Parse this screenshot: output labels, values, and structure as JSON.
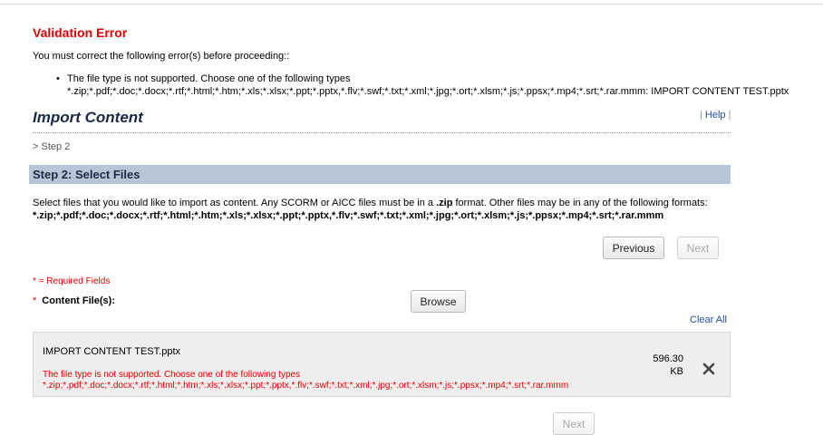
{
  "validation": {
    "title": "Validation Error",
    "intro": "You must correct the following error(s) before proceeding::",
    "error_line1": "The file type is not supported. Choose one of the following types",
    "error_line2": "*.zip;*.pdf;*.doc;*.docx;*.rtf;*.html;*.htm;*.xls;*.xlsx;*.ppt;*.pptx,*.flv;*.swf;*.txt;*.xml;*.jpg;*.ort;*.xlsm;*.js;*.ppsx;*.mp4;*.srt;*.rar.mmm: IMPORT CONTENT TEST.pptx"
  },
  "header": {
    "title": "Import Content",
    "help_label": "Help",
    "breadcrumb": "> Step 2"
  },
  "step": {
    "title": "Step 2: Select Files",
    "description_prefix": "Select files that you would like to import as content. Any SCORM or AICC files must be in a ",
    "description_zip": ".zip",
    "description_suffix": " format. Other files may be in any of the following formats:",
    "formats": "*.zip;*.pdf;*.doc;*.docx;*.rtf;*.html;*.htm;*.xls;*.xlsx;*.ppt;*.pptx,*.flv;*.swf;*.txt;*.xml;*.jpg;*.ort;*.xlsm;*.js;*.ppsx;*.mp4;*.srt;*.rar.mmm"
  },
  "nav": {
    "previous_label": "Previous",
    "next_label": "Next"
  },
  "form": {
    "required_note": "* = Required Fields",
    "required_star": "*",
    "content_files_label": "Content File(s):",
    "browse_label": "Browse",
    "clear_all_label": "Clear All"
  },
  "file": {
    "name": "IMPORT CONTENT TEST.pptx",
    "size_value": "596.30",
    "size_unit": "KB",
    "error_line1": "The file type is not supported. Choose one of the following types",
    "error_line2": "*.zip;*.pdf;*.doc;*.docx;*.rtf;*.html;*.htm;*.xls;*.xlsx;*.ppt;*.pptx,*.flv;*.swf;*.txt;*.xml;*.jpg;*.ort;*.xlsm;*.js;*.ppsx;*.mp4;*.srt;*.rar.mmm"
  },
  "icons": {
    "remove": "close-icon"
  },
  "colors": {
    "error": "#e00000",
    "link": "#1f4e9c",
    "section_header": "#b7c6d7",
    "title": "#1a2a44"
  }
}
